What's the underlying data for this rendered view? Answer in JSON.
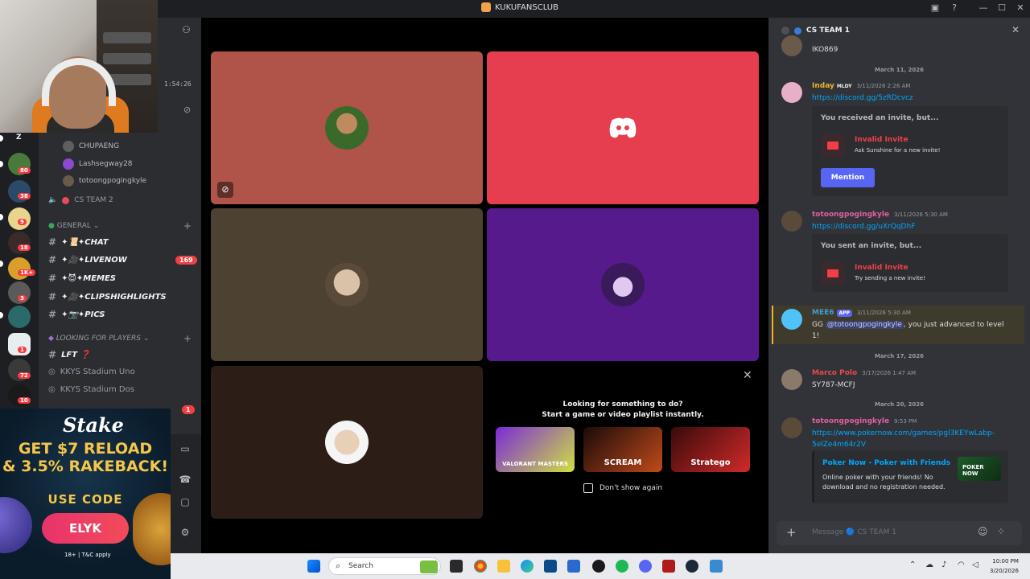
{
  "window": {
    "title": "KUKUFANSCLUB",
    "minimize": "—",
    "maximize": "☐",
    "close": "✕"
  },
  "sidebar": {
    "timer": "1:54:26",
    "voice_users": [
      "CHUPAENG",
      "Lashsegway28",
      "totoongpogingkyle"
    ],
    "voice_channel_2": "CS TEAM 2",
    "category_general": "GENERAL",
    "channels": [
      {
        "label": "✦📜✦CHAT"
      },
      {
        "label": "✦🎥✦LIVENOW",
        "badge": "169"
      },
      {
        "label": "✦😈✦MEMES"
      },
      {
        "label": "✦🎥✦CLIPSHIGHLIGHTS"
      },
      {
        "label": "✦📷✦PICS"
      }
    ],
    "category_lfp": "LOOKING FOR PLAYERS",
    "lft_label": "LFT ❓",
    "stadium_1": "KKYS Stadium Uno",
    "stadium_2": "KKYS Stadium Dos",
    "server_badges": [
      "80",
      "38",
      "9",
      "18",
      "1K+",
      "3",
      "1",
      "72",
      "10"
    ],
    "rail_top_letter": "Z",
    "bottom_badge": "1"
  },
  "ad": {
    "logo": "Stake",
    "headline_1": "GET $7 RELOAD",
    "headline_2": "& 3.5% RAKEBACK!",
    "use_code": "USE CODE",
    "code": "ELYK",
    "fine_print": "18+ | T&C apply"
  },
  "activity": {
    "lead_1": "Looking for something to do?",
    "lead_2": "Start a game or video playlist instantly.",
    "games": [
      "VALORANT MASTERS",
      "SCREAM",
      "Stratego"
    ],
    "dont_show": "Don't show again"
  },
  "chat": {
    "channel": "CS TEAM 1",
    "top_message": "IKO869",
    "date_1": "March 11, 2026",
    "msg1": {
      "name": "Inday",
      "tag": "MLDY",
      "time": "3/11/2026 2:26 AM",
      "link": "https://discord.gg/5zRDcvcz"
    },
    "invite1": {
      "head": "You received an invite, but...",
      "title": "Invalid Invite",
      "sub": "Ask Sunshine for a new invite!",
      "button": "Mention"
    },
    "msg2": {
      "name": "totoongpogingkyle",
      "time": "3/11/2026 5:30 AM",
      "link": "https://discord.gg/uXrQqDhF"
    },
    "invite2": {
      "head": "You sent an invite, but...",
      "title": "Invalid Invite",
      "sub": "Try sending a new invite!"
    },
    "msg3": {
      "name": "MEE6",
      "app": "APP",
      "time": "3/11/2026 5:30 AM",
      "prefix": "GG ",
      "mention": "@totoongpogingkyle",
      "suffix": ", you just advanced to level",
      "line2": "1!"
    },
    "date_2": "March 17, 2026",
    "msg4": {
      "name": "Marco Polo",
      "time": "3/17/2026 1:47 AM",
      "text": "SY787-MCFJ"
    },
    "date_3": "March 20, 2026",
    "msg5": {
      "name": "totoongpogingkyle",
      "time": "9:53 PM",
      "link1": "https://www.pokernow.com/games/pgl3KEYwLabp-",
      "link2": "5elZe4m64r2V"
    },
    "poker": {
      "title": "Poker Now - Poker with Friends",
      "desc": "Online poker with your friends! No download and no registration needed.",
      "thumb": "POKER NOW"
    },
    "composer_placeholder": "Message 🔵 CS TEAM 1"
  },
  "taskbar": {
    "search": "Search",
    "time": "10:00 PM",
    "date": "3/20/2026"
  },
  "colors": {
    "tile_1": "#b0544a",
    "tile_2": "#e63e4f",
    "tile_3": "#4d4232",
    "tile_4": "#561a8c",
    "tile_5": "#2c1e16",
    "blurple": "#5865f2"
  }
}
